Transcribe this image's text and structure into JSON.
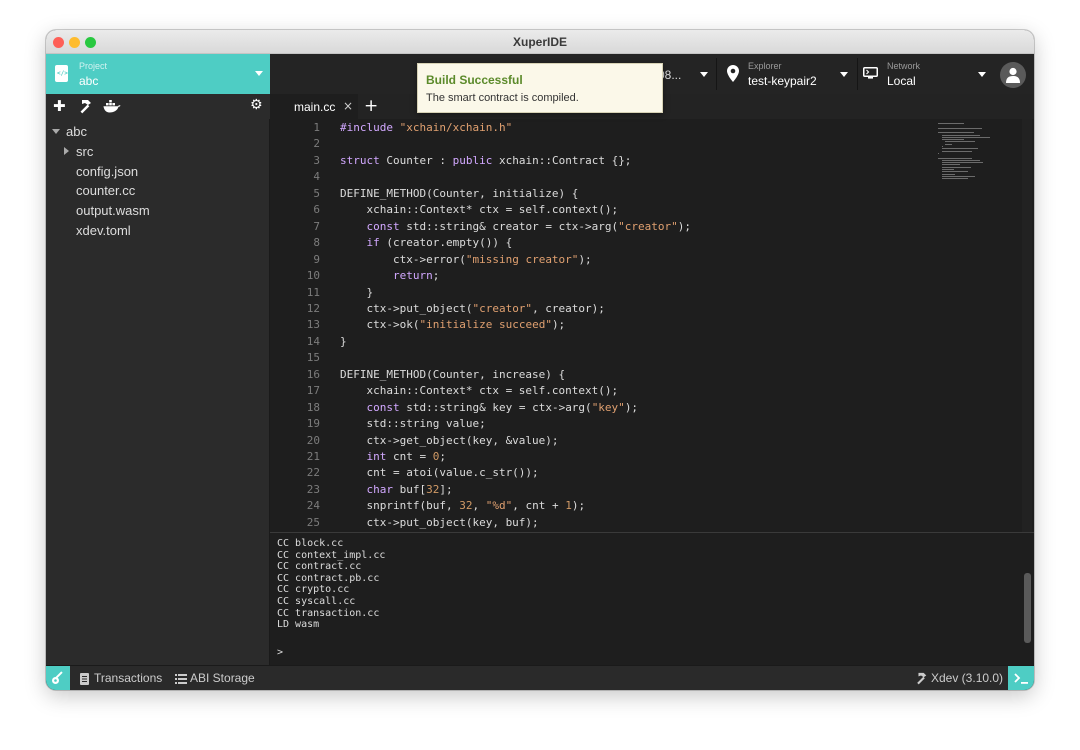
{
  "window": {
    "title": "XuperIDE"
  },
  "header": {
    "project": {
      "caption": "Project",
      "name": "abc"
    },
    "truncated_text": "08...",
    "explorer": {
      "caption": "Explorer",
      "value": "test-keypair2"
    },
    "network": {
      "caption": "Network",
      "value": "Local"
    },
    "icons": [
      "file-code-icon",
      "location-pin-icon",
      "monitor-icon",
      "user-avatar-icon"
    ]
  },
  "toast": {
    "title": "Build Successful",
    "message": "The smart contract is compiled."
  },
  "sidebar": {
    "tools": [
      "add-icon",
      "hammer-icon",
      "docker-whale-icon",
      "gear-icon"
    ],
    "tree": [
      {
        "label": "abc",
        "depth": 0,
        "kind": "folder-open"
      },
      {
        "label": "src",
        "depth": 1,
        "kind": "folder-closed"
      },
      {
        "label": "config.json",
        "depth": 1,
        "kind": "file"
      },
      {
        "label": "counter.cc",
        "depth": 1,
        "kind": "file"
      },
      {
        "label": "output.wasm",
        "depth": 1,
        "kind": "file"
      },
      {
        "label": "xdev.toml",
        "depth": 1,
        "kind": "file"
      }
    ]
  },
  "editor": {
    "tabs": [
      {
        "label": "main.cc",
        "close": "×"
      }
    ],
    "add_tab": "+",
    "lines": [
      {
        "n": "1",
        "code": "#include \"xchain/xchain.h\""
      },
      {
        "n": "2",
        "code": ""
      },
      {
        "n": "3",
        "code": "struct Counter : public xchain::Contract {};"
      },
      {
        "n": "4",
        "code": ""
      },
      {
        "n": "5",
        "code": "DEFINE_METHOD(Counter, initialize) {"
      },
      {
        "n": "6",
        "code": "    xchain::Context* ctx = self.context();"
      },
      {
        "n": "7",
        "code": "    const std::string& creator = ctx->arg(\"creator\");"
      },
      {
        "n": "8",
        "code": "    if (creator.empty()) {"
      },
      {
        "n": "9",
        "code": "        ctx->error(\"missing creator\");"
      },
      {
        "n": "10",
        "code": "        return;"
      },
      {
        "n": "11",
        "code": "    }"
      },
      {
        "n": "12",
        "code": "    ctx->put_object(\"creator\", creator);"
      },
      {
        "n": "13",
        "code": "    ctx->ok(\"initialize succeed\");"
      },
      {
        "n": "14",
        "code": "}"
      },
      {
        "n": "15",
        "code": ""
      },
      {
        "n": "16",
        "code": "DEFINE_METHOD(Counter, increase) {"
      },
      {
        "n": "17",
        "code": "    xchain::Context* ctx = self.context();"
      },
      {
        "n": "18",
        "code": "    const std::string& key = ctx->arg(\"key\");"
      },
      {
        "n": "19",
        "code": "    std::string value;"
      },
      {
        "n": "20",
        "code": "    ctx->get_object(key, &value);"
      },
      {
        "n": "21",
        "code": "    int cnt = 0;"
      },
      {
        "n": "22",
        "code": "    cnt = atoi(value.c_str());"
      },
      {
        "n": "23",
        "code": "    char buf[32];"
      },
      {
        "n": "24",
        "code": "    snprintf(buf, 32, \"%d\", cnt + 1);"
      },
      {
        "n": "25",
        "code": "    ctx->put_object(key, buf);"
      }
    ]
  },
  "terminal": {
    "lines": [
      "CC block.cc",
      "CC context_impl.cc",
      "CC contract.cc",
      "CC contract.pb.cc",
      "CC crypto.cc",
      "CC syscall.cc",
      "CC transaction.cc",
      "LD wasm"
    ],
    "prompt": ">"
  },
  "statusbar": {
    "transactions": "Transactions",
    "abi_storage": "ABI Storage",
    "xdev": "Xdev (3.10.0)",
    "icons": [
      "key-icon",
      "document-list-icon",
      "list-icon",
      "hammer-icon",
      "terminal-icon"
    ]
  },
  "colors": {
    "accent": "#4ecdc4",
    "keyword": "#d2a8ff",
    "string": "#e0a070",
    "number": "#d19a66",
    "toast_title": "#5b8a2a",
    "toast_bg": "#fbf8e9"
  }
}
